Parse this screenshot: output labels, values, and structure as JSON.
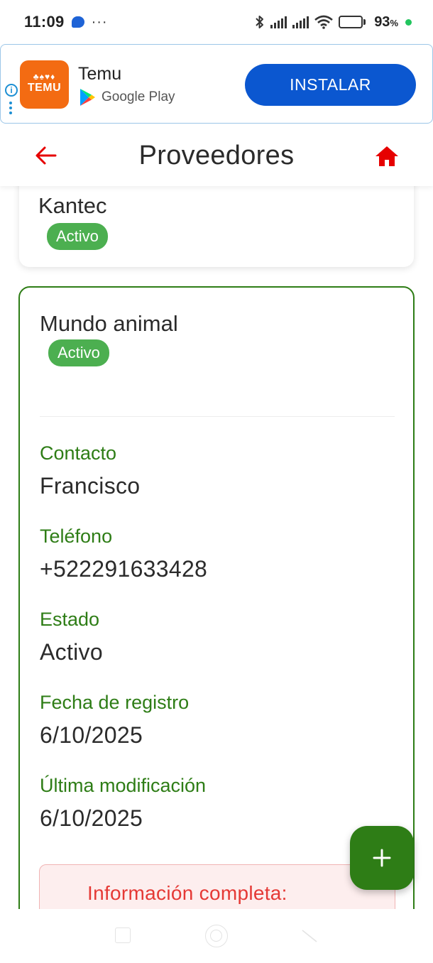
{
  "status_bar": {
    "time": "11:09",
    "dots": "···",
    "battery_percent": "93",
    "battery_unit": "%",
    "battery_level": 0.93,
    "icons": [
      "chat-icon",
      "bluetooth-icon",
      "signal-icon",
      "signal-icon",
      "wifi-icon",
      "battery-icon"
    ]
  },
  "ad": {
    "app_logo_text": "TEMU",
    "app_name": "Temu",
    "store": "Google Play",
    "install_label": "INSTALAR",
    "info_symbol": "i",
    "colors": {
      "install_button": "#0b57d0",
      "logo_bg": "#f36b12"
    }
  },
  "header": {
    "title": "Proveedores",
    "back_icon": "arrow-left-icon",
    "home_icon": "home-icon",
    "colors": {
      "icons": "#e60000"
    }
  },
  "suppliers": [
    {
      "name": "Kantec",
      "status": "Activo"
    },
    {
      "name": "Mundo animal",
      "status": "Activo",
      "details": {
        "contact_label": "Contacto",
        "contact": "Francisco",
        "phone_label": "Teléfono",
        "phone": "+522291633428",
        "state_label": "Estado",
        "state": "Activo",
        "registered_label": "Fecha de registro",
        "registered": "6/10/2025",
        "modified_label": "Última modificación",
        "modified": "6/10/2025"
      },
      "notice_title": "Información completa:"
    }
  ],
  "fab": {
    "label": "+",
    "icon": "plus-icon",
    "color": "#2e7d16"
  },
  "theme": {
    "accent_green": "#2e7d16",
    "badge_green": "#4caf50",
    "notice_red": "#e53935"
  }
}
